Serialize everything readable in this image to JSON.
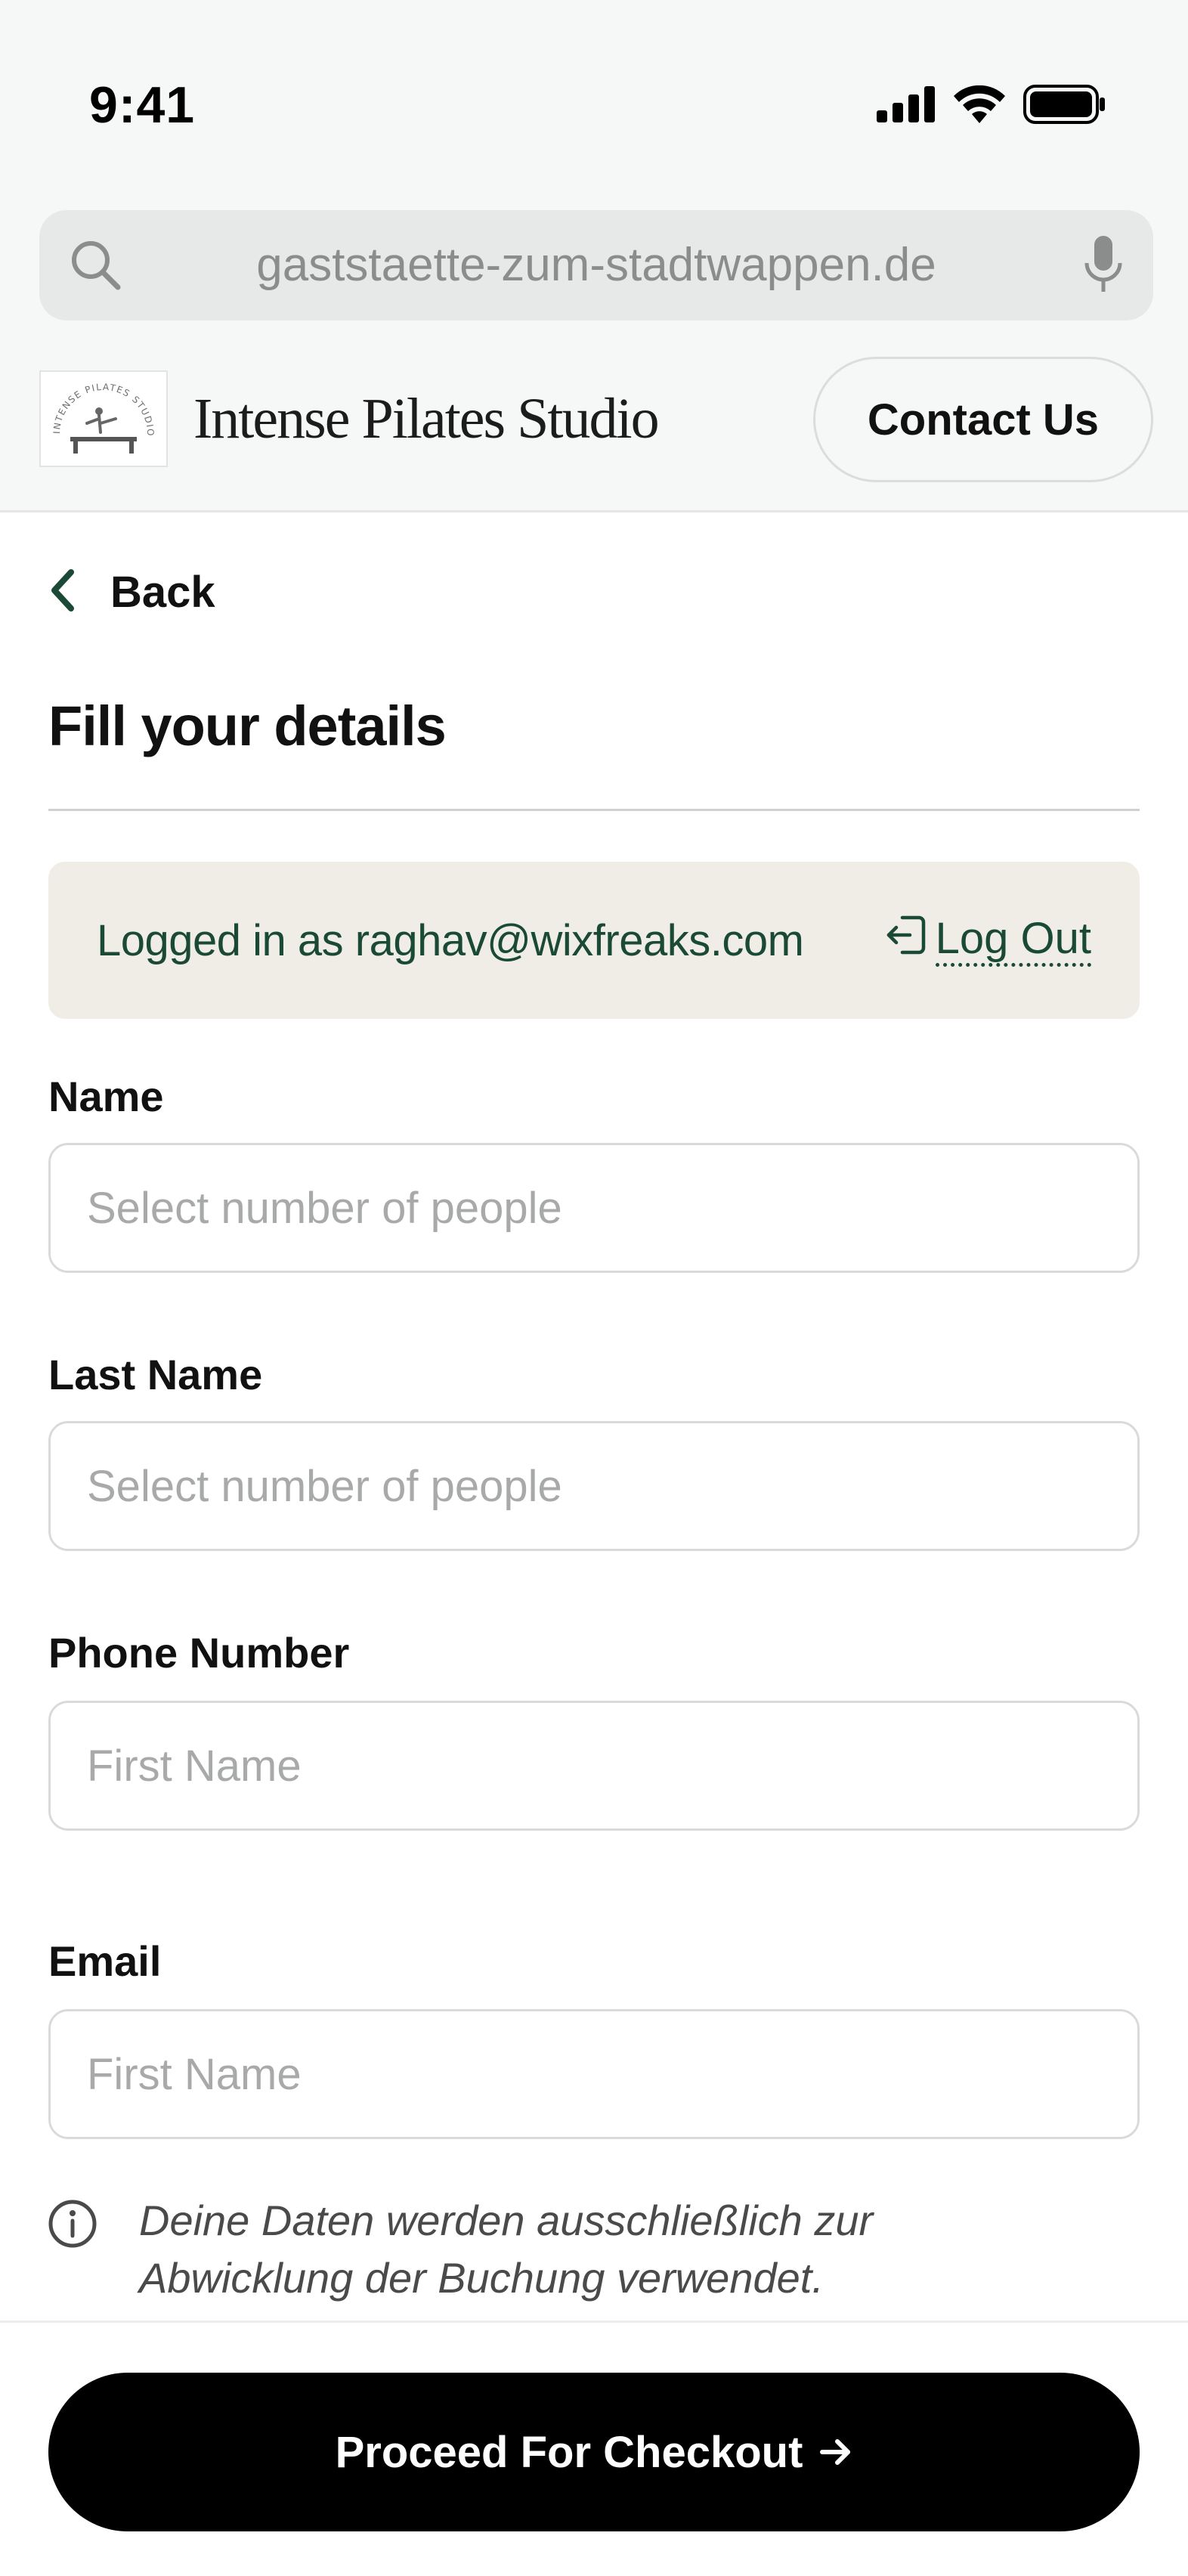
{
  "status_bar": {
    "time": "9:41"
  },
  "browser": {
    "url": "gaststaette-zum-stadtwappen.de"
  },
  "header": {
    "brand_name": "Intense Pilates Studio",
    "logo_text": "INTENSE PILATES STUDIO",
    "contact_label": "Contact Us"
  },
  "nav": {
    "back_label": "Back"
  },
  "page": {
    "title": "Fill your details"
  },
  "login": {
    "logged_in_text": "Logged in as raghav@wixfreaks.com",
    "logout_label": "Log Out"
  },
  "form": {
    "fields": [
      {
        "label": "Name",
        "placeholder": "Select number of people",
        "value": ""
      },
      {
        "label": "Last Name",
        "placeholder": "Select number of people",
        "value": ""
      },
      {
        "label": "Phone Number",
        "placeholder": "First Name",
        "value": ""
      },
      {
        "label": "Email",
        "placeholder": "First Name",
        "value": ""
      }
    ]
  },
  "info": {
    "text": "Deine Daten werden ausschließlich zur Abwicklung der Buchung verwendet."
  },
  "checkout": {
    "label": "Proceed For Checkout"
  },
  "colors": {
    "accent_green": "#1a4a35",
    "login_bg": "#efede6",
    "button_bg": "#000000",
    "chrome_bg": "#f6f8f7"
  },
  "icons": [
    "search-icon",
    "microphone-icon",
    "signal-icon",
    "wifi-icon",
    "battery-icon",
    "chevron-left-icon",
    "logout-icon",
    "info-icon",
    "arrow-right-icon"
  ]
}
